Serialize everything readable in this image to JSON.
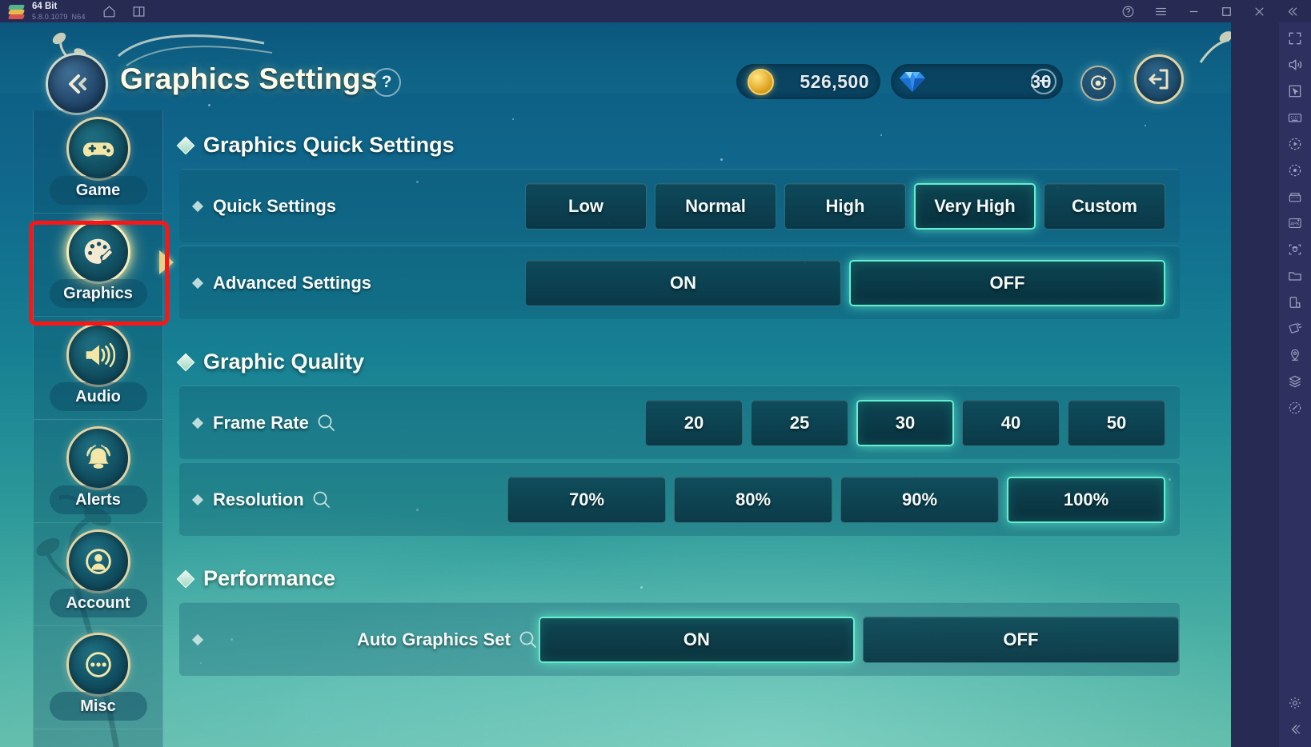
{
  "emulator": {
    "app_name": "64 Bit",
    "version": "5.8.0.1079",
    "arch": "N64",
    "titlebar_icons": [
      "home-icon",
      "multi-instance-icon"
    ],
    "window_controls": [
      "help-icon",
      "menu-icon",
      "minimize-icon",
      "maximize-icon",
      "close-icon",
      "collapse-icon"
    ],
    "rail_icons": [
      "fullscreen-icon",
      "volume-icon",
      "pointer-icon",
      "keyboard-icon",
      "macro-play-icon",
      "macro-record-icon",
      "multi-instance-manager-icon",
      "apk-install-icon",
      "screenshot-icon",
      "folder-icon",
      "copy-to-phone-icon",
      "rotate-icon",
      "location-icon",
      "layers-icon",
      "performance-icon"
    ],
    "rail_bottom_icons": [
      "settings-icon",
      "collapse-rail-icon"
    ]
  },
  "header": {
    "back_icon": "back-arrow-icon",
    "title": "Graphics Settings",
    "help_label": "?",
    "gold": {
      "icon": "gold-coin-icon",
      "value": "526,500"
    },
    "gem": {
      "icon": "diamond-gem-icon",
      "value": "30",
      "add_label": "+"
    },
    "orb_icon": "orbit-icon",
    "exit_icon": "exit-door-icon"
  },
  "sidebar": {
    "items": [
      {
        "label": "Game",
        "icon": "gamepad-icon",
        "active": false
      },
      {
        "label": "Graphics",
        "icon": "palette-icon",
        "active": true
      },
      {
        "label": "Audio",
        "icon": "speaker-icon",
        "active": false
      },
      {
        "label": "Alerts",
        "icon": "bell-icon",
        "active": false
      },
      {
        "label": "Account",
        "icon": "person-icon",
        "active": false
      },
      {
        "label": "Misc",
        "icon": "ellipsis-icon",
        "active": false
      }
    ],
    "highlight_annotation": "Graphics"
  },
  "sections": [
    {
      "title": "Graphics Quick Settings",
      "rows": [
        {
          "label": "Quick Settings",
          "has_info": false,
          "option_width": "w-quick",
          "options": [
            {
              "label": "Low",
              "selected": false
            },
            {
              "label": "Normal",
              "selected": false
            },
            {
              "label": "High",
              "selected": false
            },
            {
              "label": "Very High",
              "selected": true
            },
            {
              "label": "Custom",
              "selected": false
            }
          ]
        },
        {
          "label": "Advanced Settings",
          "has_info": false,
          "option_width": "w-toggle",
          "options": [
            {
              "label": "ON",
              "selected": false
            },
            {
              "label": "OFF",
              "selected": true
            }
          ]
        }
      ]
    },
    {
      "title": "Graphic Quality",
      "rows": [
        {
          "label": "Frame Rate",
          "has_info": true,
          "option_width": "w-num",
          "options": [
            {
              "label": "20",
              "selected": false
            },
            {
              "label": "25",
              "selected": false
            },
            {
              "label": "30",
              "selected": true
            },
            {
              "label": "40",
              "selected": false
            },
            {
              "label": "50",
              "selected": false
            }
          ]
        },
        {
          "label": "Resolution",
          "has_info": true,
          "option_width": "w-pct",
          "options": [
            {
              "label": "70%",
              "selected": false
            },
            {
              "label": "80%",
              "selected": false
            },
            {
              "label": "90%",
              "selected": false
            },
            {
              "label": "100%",
              "selected": true
            }
          ]
        }
      ]
    },
    {
      "title": "Performance",
      "rows": [
        {
          "label": "Auto Graphics Set",
          "has_info": true,
          "label_centered": true,
          "option_width": "w-toggle",
          "options": [
            {
              "label": "ON",
              "selected": true
            },
            {
              "label": "OFF",
              "selected": false
            }
          ]
        }
      ]
    }
  ],
  "colors": {
    "accent_selected": "#63f0cf",
    "annotation_red": "#ff1414",
    "gold_trim": "#dfd2a3",
    "chrome_bg": "#272a52",
    "rail_bg": "#2e3160"
  }
}
